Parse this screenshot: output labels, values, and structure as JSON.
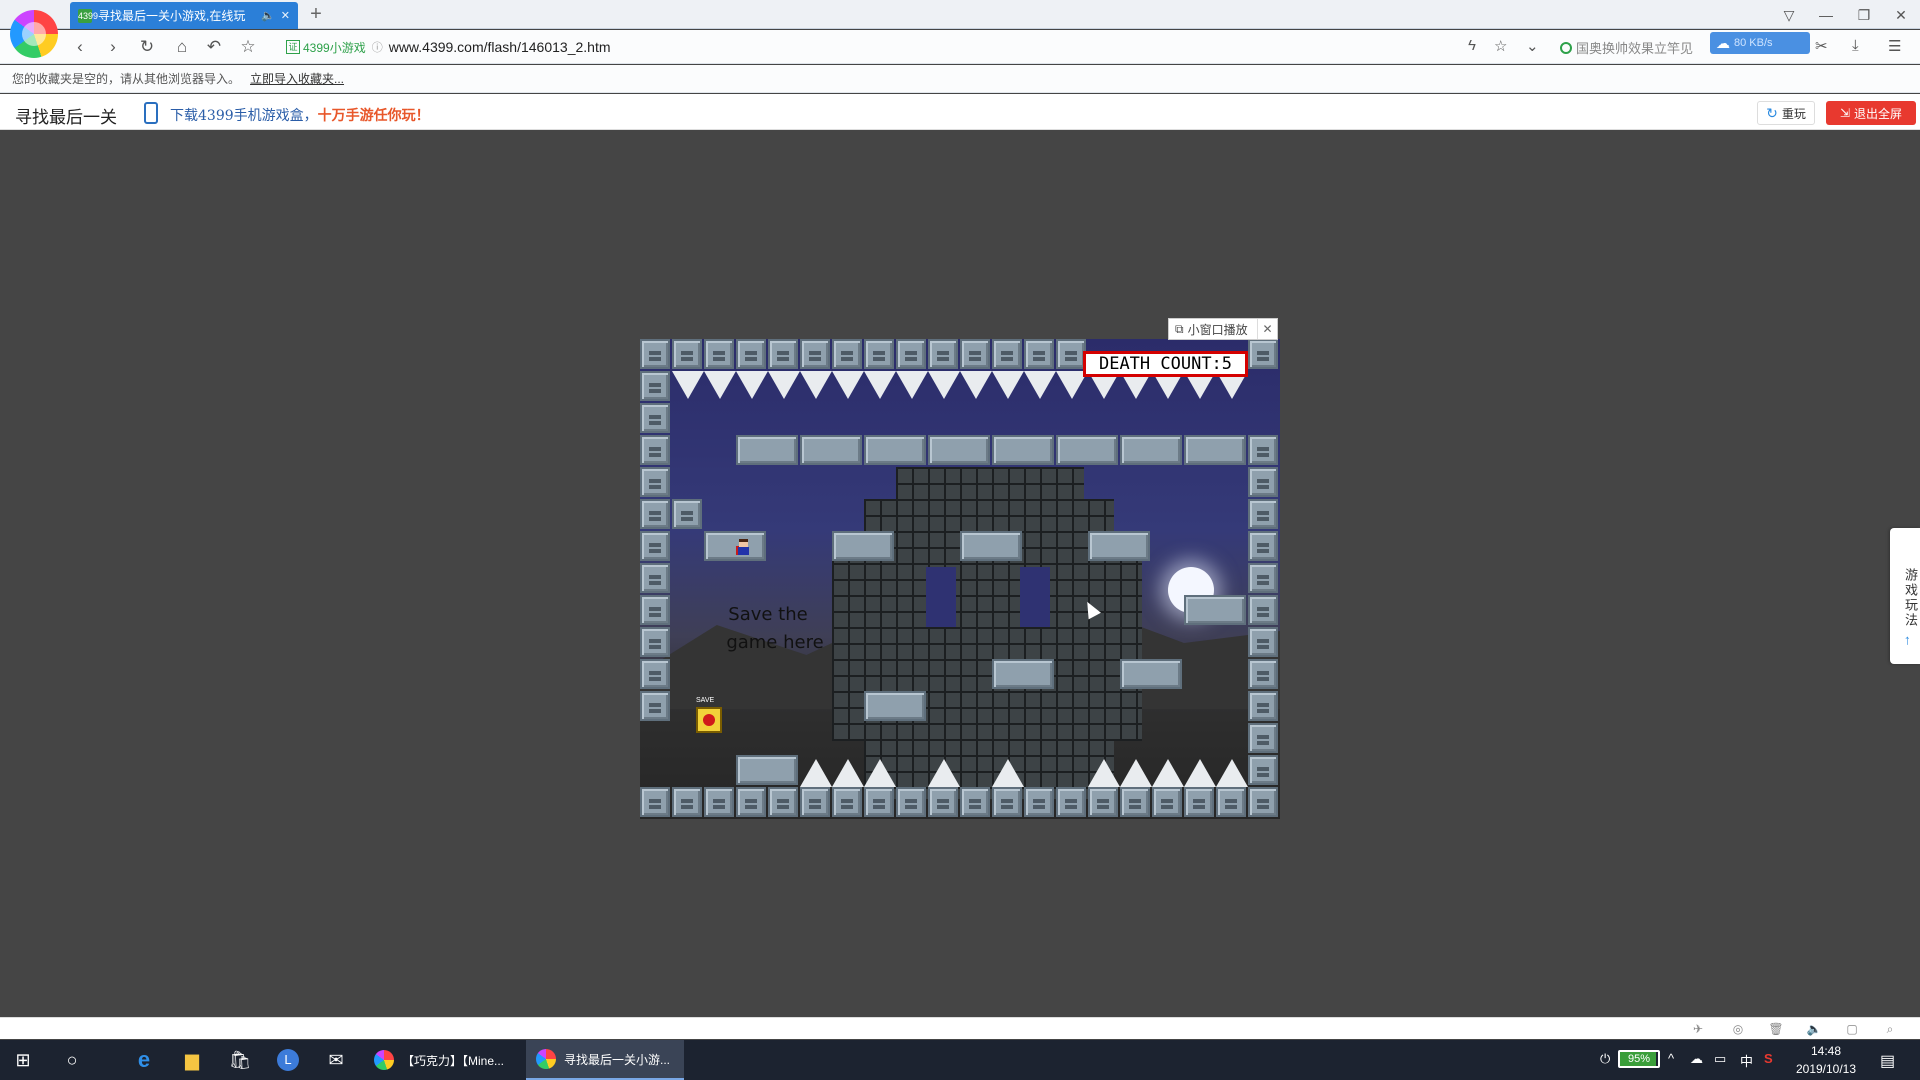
{
  "browser": {
    "tab_title": "寻找最后一关小游戏,在线玩",
    "tab_favicon": "4399",
    "tab_mute_icon": "🔈",
    "new_tab": "+",
    "url_site_label": "4399小游戏",
    "url": "www.4399.com/flash/146013_2.htm",
    "hint_text": "国奥换帅效果立竿见",
    "net_speed": "80 KB/s"
  },
  "bookmarks": {
    "empty_msg": "您的收藏夹是空的，请从其他浏览器导入。",
    "import_link": "立即导入收藏夹..."
  },
  "game_header": {
    "title": "寻找最后一关",
    "promo_prefix": "下载4399手机游戏盒，",
    "promo_highlight": "十万手游任你玩！",
    "replay_label": "重玩",
    "exit_fullscreen_label": "退出全屏"
  },
  "game": {
    "popout_label": "小窗口播放",
    "death_count": "DEATH COUNT:5",
    "save_hint_line1": "Save the",
    "save_hint_line2": "game here",
    "save_label": "SAVE"
  },
  "side_tab": {
    "label": "游戏玩法"
  },
  "taskbar": {
    "app1_label": "【巧克力】【Mine...",
    "app2_label": "寻找最后一关小游...",
    "battery": "95%",
    "ime": "中",
    "time": "14:48",
    "date": "2019/10/13"
  }
}
